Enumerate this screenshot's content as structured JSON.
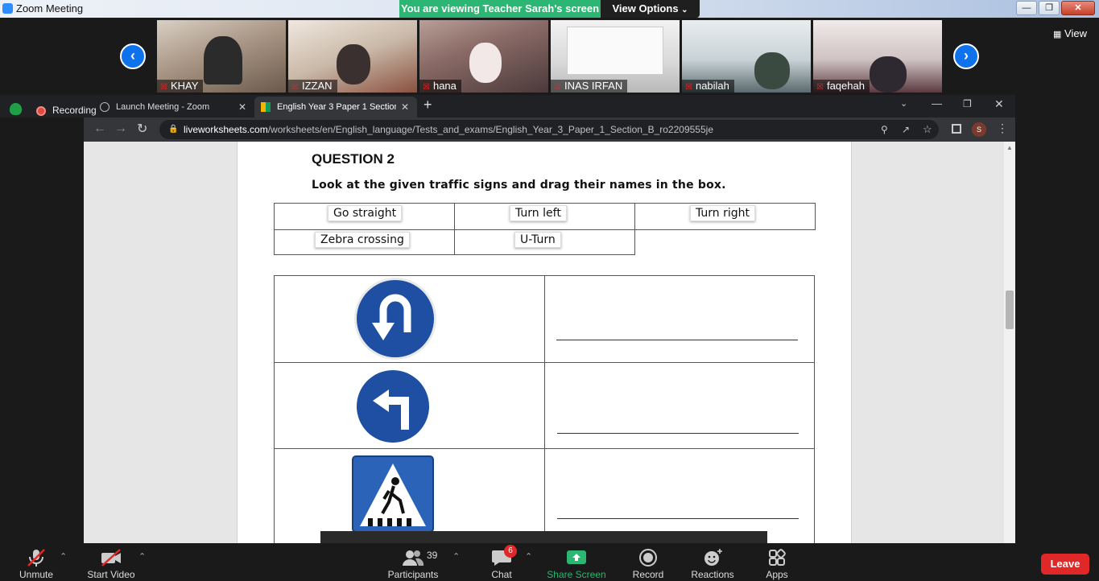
{
  "window": {
    "title": "Zoom Meeting"
  },
  "banner": {
    "viewing": "You are viewing Teacher Sarah's screen",
    "view_options": "View Options"
  },
  "gallery": {
    "participants": [
      {
        "name": "KHAY"
      },
      {
        "name": "IZZAN"
      },
      {
        "name": "hana"
      },
      {
        "name": "INAS IRFAN"
      },
      {
        "name": "nabilah"
      },
      {
        "name": "faqehah"
      }
    ],
    "view_label": "View"
  },
  "browser": {
    "recording_label": "Recording",
    "tabs": [
      {
        "title": "Launch Meeting - Zoom"
      },
      {
        "title": "English Year 3 Paper 1 Section B"
      }
    ],
    "url_domain": "liveworksheets.com",
    "url_path": "/worksheets/en/English_language/Tests_and_exams/English_Year_3_Paper_1_Section_B_ro2209555je",
    "profile_initial": "S"
  },
  "worksheet": {
    "title": "QUESTION 2",
    "instruction": "Look at the given traffic signs and drag their names in the box.",
    "word_bank": [
      "Go straight",
      "Turn left",
      "Turn right",
      "Zebra crossing",
      "U-Turn"
    ],
    "signs": [
      {
        "icon": "u-turn-sign"
      },
      {
        "icon": "turn-left-sign"
      },
      {
        "icon": "zebra-crossing-sign"
      }
    ]
  },
  "controls": {
    "unmute": "Unmute",
    "start_video": "Start Video",
    "participants": "Participants",
    "participants_count": "39",
    "chat": "Chat",
    "chat_badge": "6",
    "share_screen": "Share Screen",
    "record": "Record",
    "reactions": "Reactions",
    "apps": "Apps",
    "leave": "Leave"
  },
  "colors": {
    "zoom_blue": "#0e72ed",
    "share_green": "#2bb673",
    "leave_red": "#e02828",
    "sign_blue": "#1e4fa3"
  }
}
